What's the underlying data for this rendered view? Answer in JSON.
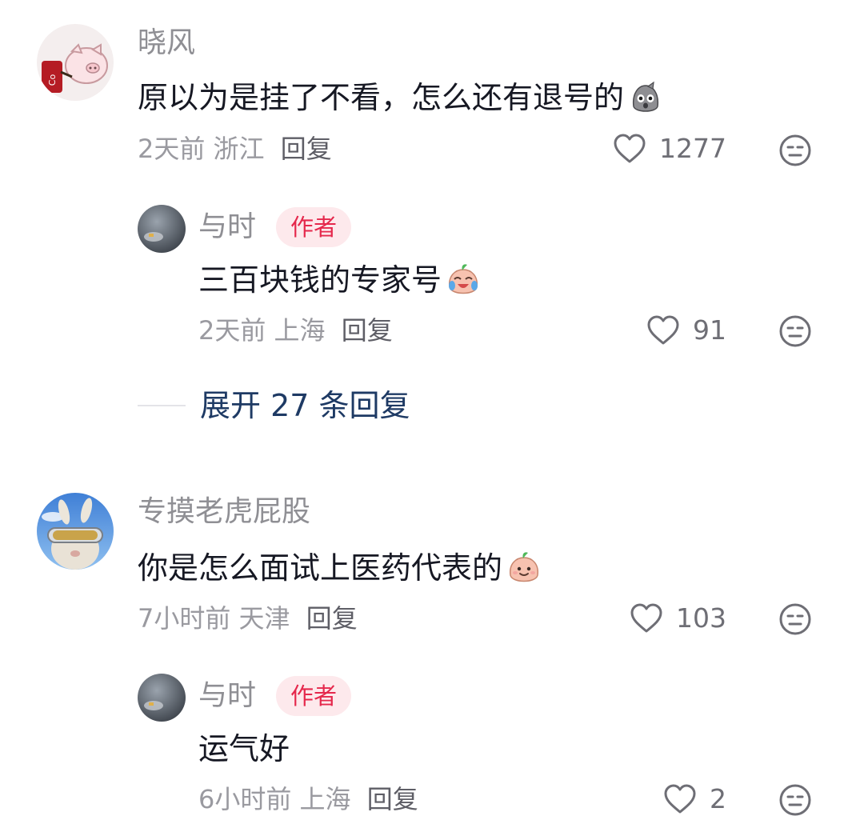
{
  "comments": [
    {
      "user": "晓风",
      "text": "原以为是挂了不看，怎么还有退号的",
      "emoji": "shocked-face-emoji",
      "time": "2天前",
      "location": "浙江",
      "reply_label": "回复",
      "likes": "1277",
      "reply": {
        "user": "与时",
        "badge": "作者",
        "text": "三百块钱的专家号",
        "emoji": "crying-laughing-emoji",
        "time": "2天前",
        "location": "上海",
        "reply_label": "回复",
        "likes": "91"
      },
      "expand": "展开 27 条回复"
    },
    {
      "user": "专摸老虎屁股",
      "text": "你是怎么面试上医药代表的",
      "emoji": "smiling-peach-emoji",
      "time": "7小时前",
      "location": "天津",
      "reply_label": "回复",
      "likes": "103",
      "reply": {
        "user": "与时",
        "badge": "作者",
        "text": "运气好",
        "time": "6小时前",
        "location": "上海",
        "reply_label": "回复",
        "likes": "2"
      }
    }
  ],
  "colors": {
    "author_badge_bg": "#fde9ec",
    "author_badge_text": "#e5284c",
    "expand_text": "#1e3a64"
  }
}
